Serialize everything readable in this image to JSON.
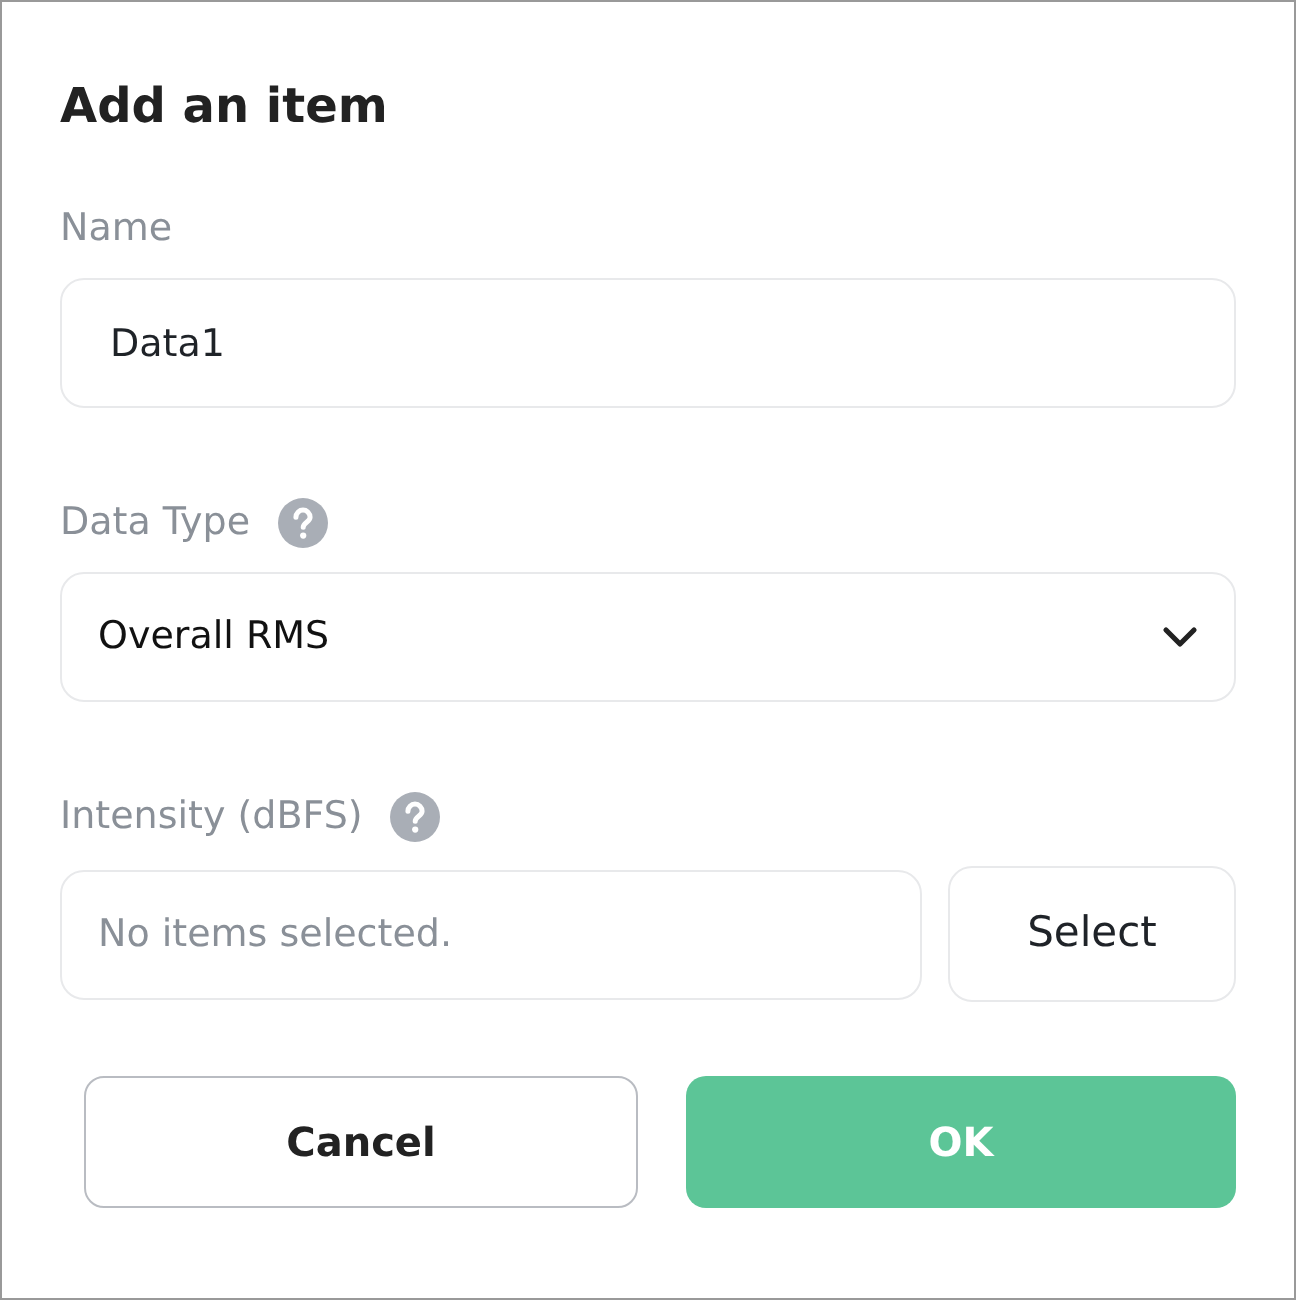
{
  "dialog": {
    "title": "Add an item"
  },
  "fields": [
    {
      "kind": "text",
      "label": "Name",
      "value": "Data1",
      "help": false
    },
    {
      "kind": "select",
      "label": "Data Type",
      "value": "Overall RMS",
      "help": true
    },
    {
      "kind": "picker",
      "label": "Intensity (dBFS)",
      "placeholder": "No items selected.",
      "button": "Select",
      "help": true
    }
  ],
  "buttons": [
    {
      "label": "Cancel",
      "kind": "secondary"
    },
    {
      "label": "OK",
      "kind": "primary"
    }
  ]
}
